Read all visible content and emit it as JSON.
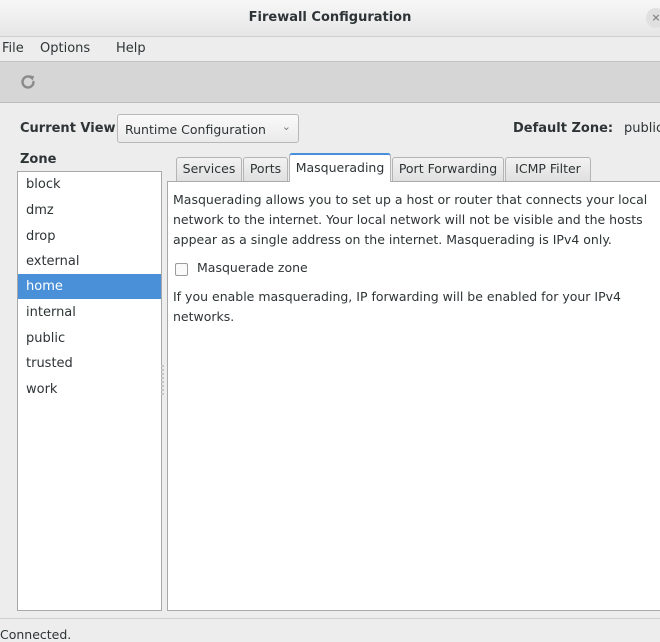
{
  "window": {
    "title": "Firewall Configuration",
    "close_glyph": "×"
  },
  "menu": [
    "File",
    "Options",
    "Help"
  ],
  "toolbar": {
    "reload_icon": "reload-icon"
  },
  "current_view": {
    "label": "Current View:",
    "value": "Runtime Configuration",
    "arrow_glyph": "⌄"
  },
  "default_zone": {
    "label": "Default Zone:",
    "value": "public"
  },
  "zones": {
    "label": "Zone",
    "items": [
      "block",
      "dmz",
      "drop",
      "external",
      "home",
      "internal",
      "public",
      "trusted",
      "work"
    ],
    "selected": "home"
  },
  "tabs": [
    "Services",
    "Ports",
    "Masquerading",
    "Port Forwarding",
    "ICMP Filter"
  ],
  "active_tab": "Masquerading",
  "masquerading": {
    "description": "Masquerading allows you to set up a host or router that connects your local network to the internet. Your local network will not be visible and the hosts appear as a single address on the internet. Masquerading is IPv4 only.",
    "checkbox_label": "Masquerade zone",
    "checkbox_checked": false,
    "note": "If you enable masquerading, IP forwarding will be enabled for your IPv4 networks."
  },
  "status": "Connected."
}
